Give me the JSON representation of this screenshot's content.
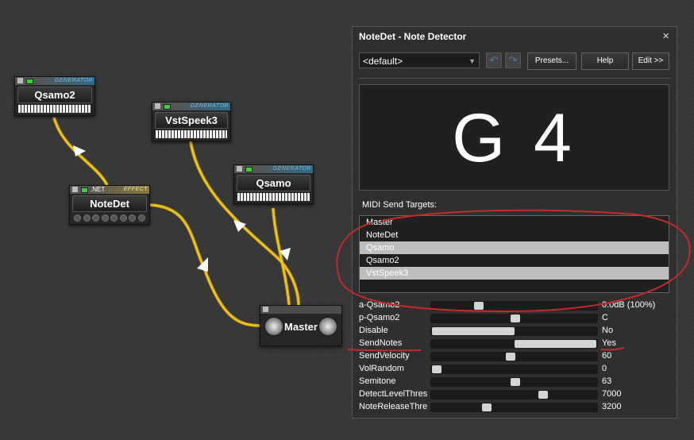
{
  "nodes": {
    "qsamo2": {
      "title": "Qsamo2",
      "tag": "GENERATOR"
    },
    "vstspeek3": {
      "title": "VstSpeek3",
      "tag": "GENERATOR"
    },
    "qsamo": {
      "title": "Qsamo",
      "tag": "GENERATOR"
    },
    "notedet": {
      "title": "NoteDet",
      "tag": "EFFECT",
      "net": ".NET"
    },
    "master": {
      "title": "Master"
    }
  },
  "panel": {
    "title": "NoteDet - Note Detector",
    "close": "×",
    "preset_value": "<default>",
    "presets_label": "Presets...",
    "help_label": "Help",
    "edit_label": "Edit >>",
    "detected_note": "G 4",
    "midi_label": "MIDI Send Targets:",
    "targets": [
      {
        "label": "Master",
        "selected": false
      },
      {
        "label": "NoteDet",
        "selected": false
      },
      {
        "label": "Qsamo",
        "selected": true
      },
      {
        "label": "Qsamo2",
        "selected": false
      },
      {
        "label": "VstSpeek3",
        "selected": true
      }
    ],
    "params": [
      {
        "label": "a-Qsamo2",
        "value": "0.0dB (100%)",
        "pos": 0.27,
        "fill": false
      },
      {
        "label": "p-Qsamo2",
        "value": "C",
        "pos": 0.5,
        "fill": false
      },
      {
        "label": "Disable",
        "value": "No",
        "pos": 0.5,
        "fill": true
      },
      {
        "label": "SendNotes",
        "value": "Yes",
        "pos": 0.5,
        "fill": true,
        "right": true
      },
      {
        "label": "SendVelocity",
        "value": "60",
        "pos": 0.47,
        "fill": false
      },
      {
        "label": "VolRandom",
        "value": "0",
        "pos": 0.0,
        "fill": false
      },
      {
        "label": "Semitone",
        "value": "63",
        "pos": 0.5,
        "fill": false
      },
      {
        "label": "DetectLevelThres",
        "value": "7000",
        "pos": 0.68,
        "fill": false
      },
      {
        "label": "NoteReleaseThre",
        "value": "3200",
        "pos": 0.32,
        "fill": false
      }
    ]
  },
  "colors": {
    "wire": "#f4c61a",
    "annotation": "#c42a2a",
    "selected": "#bdbdbd"
  }
}
